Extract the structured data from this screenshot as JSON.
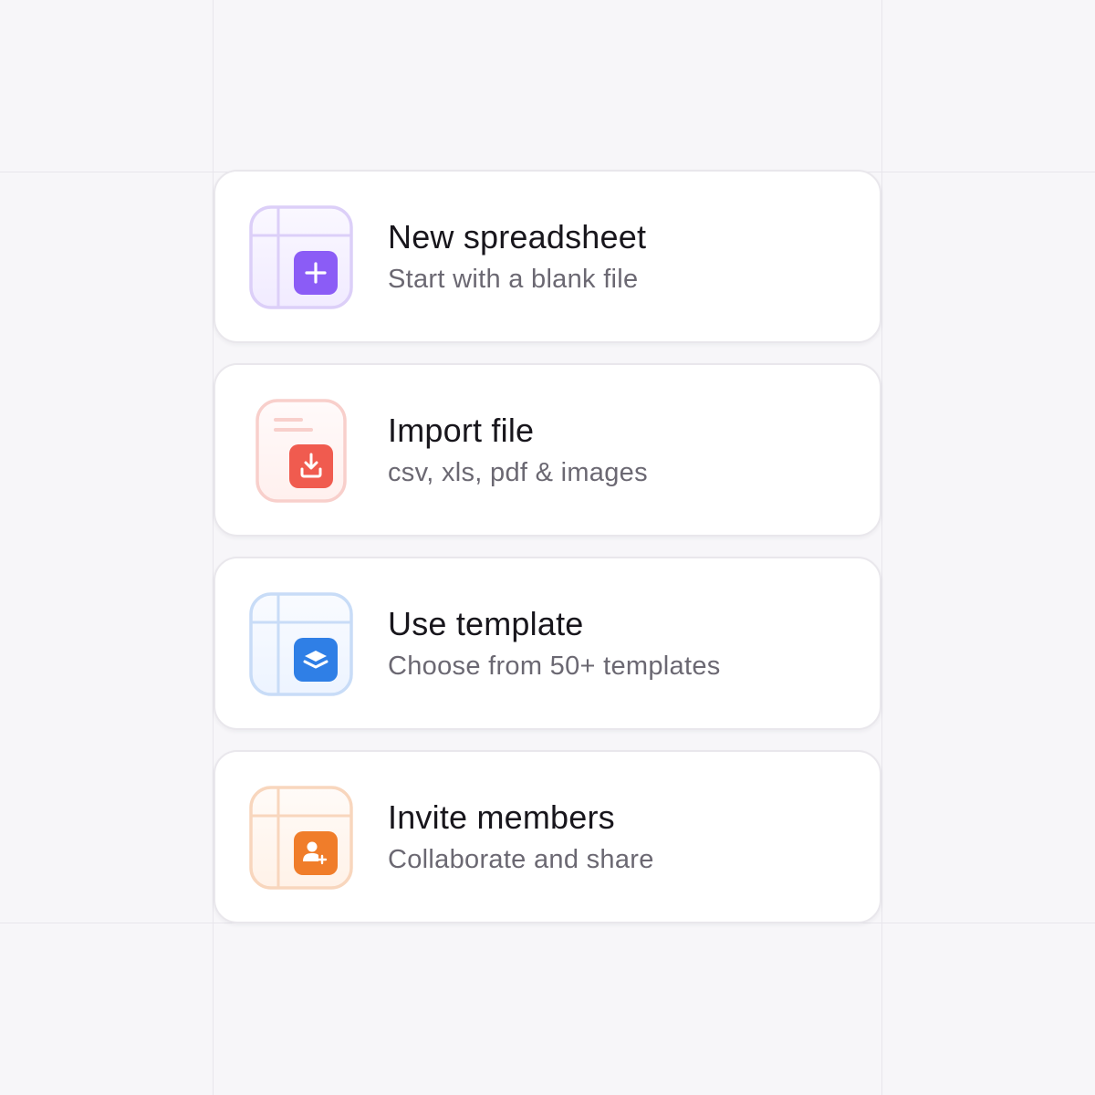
{
  "cards": [
    {
      "title": "New spreadsheet",
      "subtitle": "Start with a blank file",
      "icon": "plus-icon",
      "accent": "#8b5cf6",
      "tint": "#d9ccf7"
    },
    {
      "title": "Import file",
      "subtitle": "csv, xls, pdf & images",
      "icon": "download-icon",
      "accent": "#f05b4f",
      "tint": "#f8ccc8"
    },
    {
      "title": "Use template",
      "subtitle": "Choose from 50+ templates",
      "icon": "layers-icon",
      "accent": "#2f7fe6",
      "tint": "#c6dbf6"
    },
    {
      "title": "Invite members",
      "subtitle": "Collaborate and share",
      "icon": "user-plus-icon",
      "accent": "#f07d2a",
      "tint": "#f8d4b8"
    }
  ]
}
